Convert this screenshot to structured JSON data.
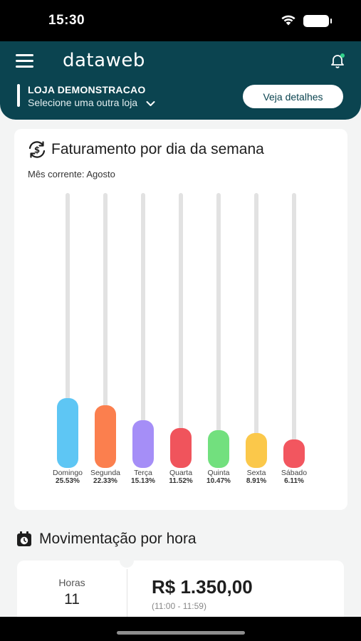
{
  "status": {
    "time": "15:30"
  },
  "header": {
    "logo": "dataweb",
    "store_name": "LOJA DEMONSTRACAO",
    "store_select": "Selecione uma outra loja",
    "details_button": "Veja detalhes"
  },
  "card": {
    "title": "Faturamento por dia da semana",
    "subtitle": "Mês corrente: Agosto",
    "icon": "dollar-refresh-icon"
  },
  "chart_data": {
    "type": "bar",
    "categories": [
      "Domingo",
      "Segunda",
      "Terça",
      "Quarta",
      "Quinta",
      "Sexta",
      "Sábado"
    ],
    "values": [
      25.53,
      22.33,
      15.13,
      11.52,
      10.47,
      8.91,
      6.11
    ],
    "labels": [
      "25.53%",
      "22.33%",
      "15.13%",
      "11.52%",
      "10.47%",
      "8.91%",
      "6.11%"
    ],
    "colors": [
      "#5ec6f4",
      "#fb7f4e",
      "#a58ef7",
      "#f0545c",
      "#72e07e",
      "#fbc84a",
      "#f2565f"
    ],
    "track_color": "#e2e2e2",
    "ylim": [
      0,
      100
    ]
  },
  "section2": {
    "title": "Movimentação por hora",
    "icon": "calendar-clock-icon",
    "hour_label": "Horas",
    "hour_value": "11",
    "amount": "R$ 1.350,00",
    "range": "(11:00 - 11:59)"
  }
}
